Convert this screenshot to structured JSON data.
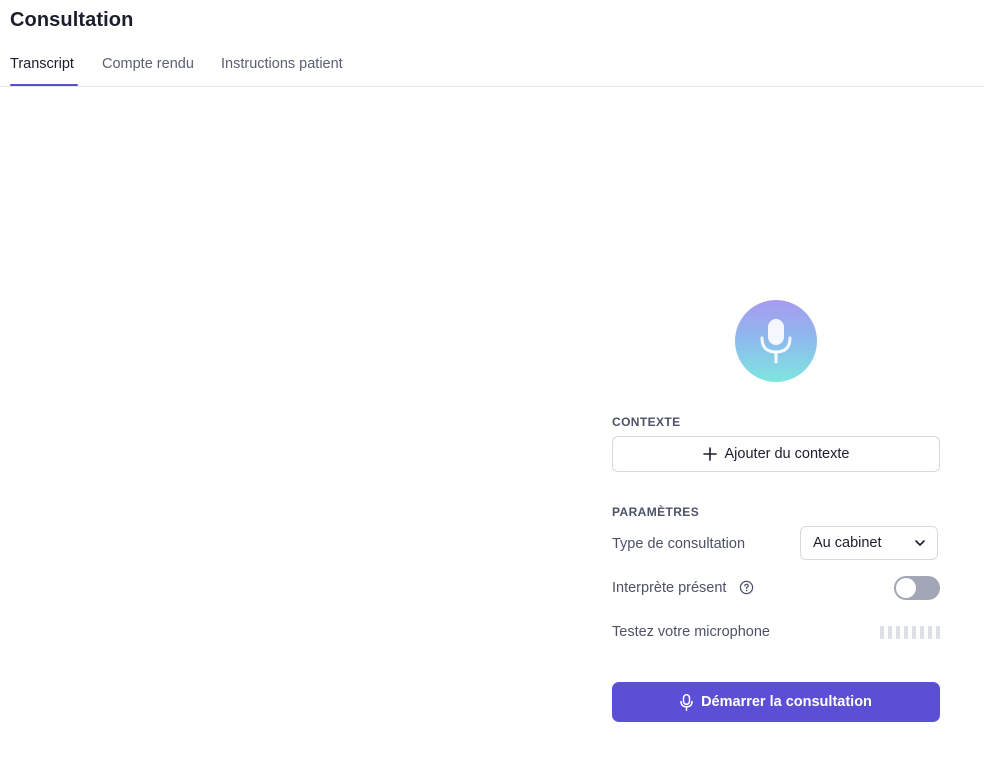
{
  "header": {
    "title": "Consultation"
  },
  "tabs": [
    {
      "label": "Transcript",
      "active": true
    },
    {
      "label": "Compte rendu",
      "active": false
    },
    {
      "label": "Instructions patient",
      "active": false
    }
  ],
  "context": {
    "section_label": "CONTEXTE",
    "add_button_label": "Ajouter du contexte",
    "add_icon": "plus-icon"
  },
  "settings": {
    "section_label": "PARAMÈTRES",
    "consultation_type": {
      "label": "Type de consultation",
      "value": "Au cabinet"
    },
    "interpreter": {
      "label": "Interprète présent",
      "enabled": false,
      "help_icon": "help-circle-icon"
    },
    "mic_test": {
      "label": "Testez votre microphone",
      "level": 0
    }
  },
  "start_button": {
    "label": "Démarrer la consultation",
    "icon": "microphone-icon"
  },
  "colors": {
    "accent": "#5b4fd6",
    "toggle_off": "#a3a6b6",
    "avatar_gradient_top": "#a89af0",
    "avatar_gradient_bottom": "#7ee6df"
  }
}
